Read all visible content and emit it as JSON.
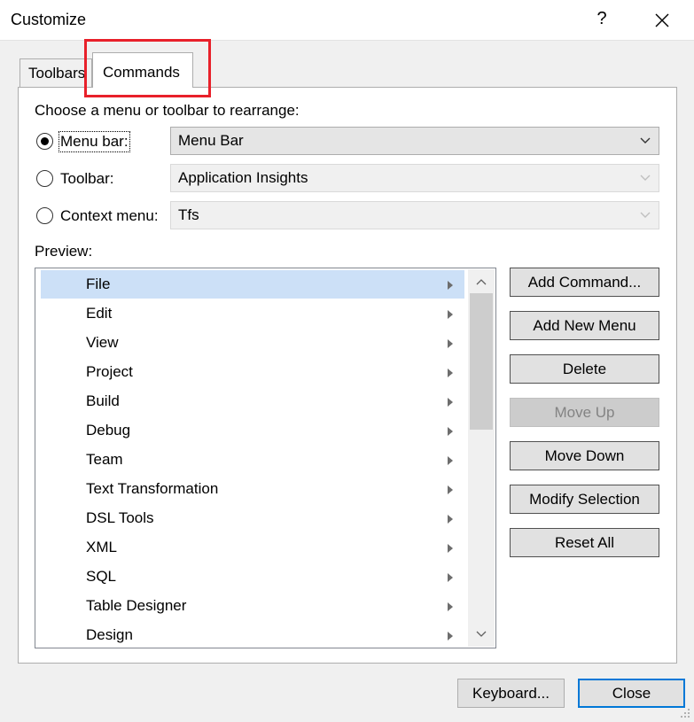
{
  "window": {
    "title": "Customize",
    "help_label": "?",
    "close_icon": "close-icon"
  },
  "tabs": [
    {
      "label": "Toolbars",
      "active": false
    },
    {
      "label": "Commands",
      "active": true
    }
  ],
  "annotation": {
    "color": "#e8202a"
  },
  "choose_label": "Choose a menu or toolbar to rearrange:",
  "options": [
    {
      "label": "Menu bar:",
      "checked": true,
      "combo_value": "Menu Bar",
      "enabled": true
    },
    {
      "label": "Toolbar:",
      "checked": false,
      "combo_value": "Application Insights",
      "enabled": false
    },
    {
      "label": "Context menu:",
      "checked": false,
      "combo_value": "Tfs",
      "enabled": false
    }
  ],
  "preview_label": "Preview:",
  "preview_items": [
    "File",
    "Edit",
    "View",
    "Project",
    "Build",
    "Debug",
    "Team",
    "Text Transformation",
    "DSL Tools",
    "XML",
    "SQL",
    "Table Designer",
    "Design"
  ],
  "selected_item": "File",
  "colors": {
    "selection": "#cce0f7",
    "default_button_border": "#0078d7"
  },
  "side_buttons": [
    {
      "label": "Add Command...",
      "enabled": true
    },
    {
      "label": "Add New Menu",
      "enabled": true
    },
    {
      "label": "Delete",
      "enabled": true
    },
    {
      "label": "Move Up",
      "enabled": false
    },
    {
      "label": "Move Down",
      "enabled": true
    },
    {
      "label": "Modify Selection",
      "enabled": true
    },
    {
      "label": "Reset All",
      "enabled": true
    }
  ],
  "footer": {
    "keyboard_label": "Keyboard...",
    "close_label": "Close"
  }
}
